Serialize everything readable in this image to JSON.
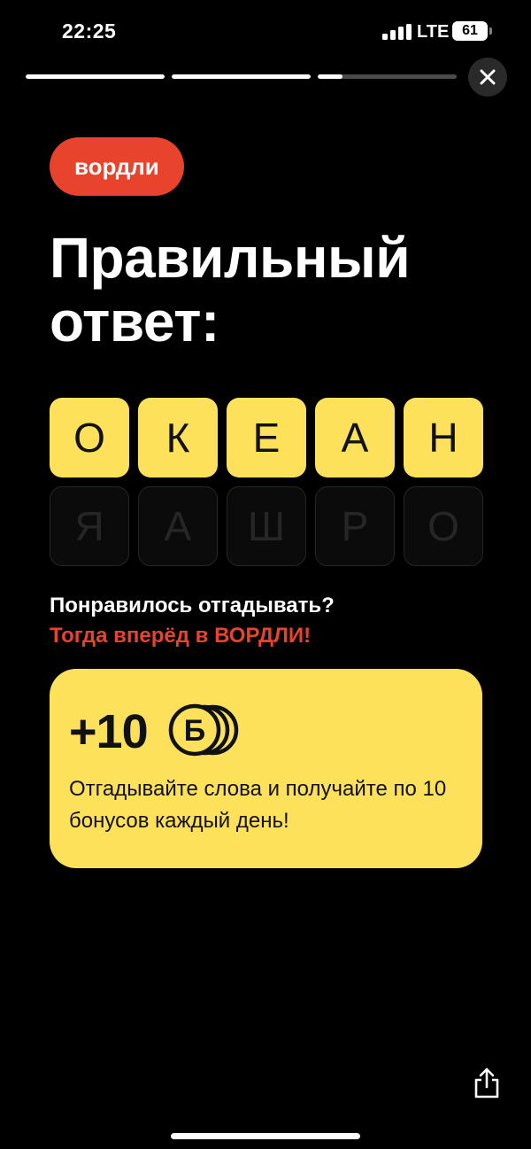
{
  "status_bar": {
    "time": "22:25",
    "network": "LTE",
    "battery": "61"
  },
  "progress": {
    "segments": [
      {
        "fill": 1.0
      },
      {
        "fill": 1.0
      },
      {
        "fill": 0.18
      }
    ]
  },
  "badge": {
    "label": "вордли"
  },
  "title": {
    "line1": "Правильный",
    "line2": "ответ:"
  },
  "answer_tiles": [
    "О",
    "К",
    "Е",
    "А",
    "Н"
  ],
  "hint_tiles": [
    "Я",
    "А",
    "Ш",
    "Р",
    "О"
  ],
  "promo": {
    "line1": "Понравилось отгадывать?",
    "line2": "Тогда вперёд в ВОРДЛИ!"
  },
  "bonus_card": {
    "amount": "+10",
    "coin_symbol": "Б",
    "text": "Отгадывайте слова и получайте по 10 бонусов каждый день!"
  },
  "colors": {
    "accent_red": "#e8432c",
    "accent_yellow": "#fde15b",
    "background": "#000000"
  },
  "icons": {
    "close": "close-icon",
    "share": "share-icon",
    "coin": "coin-icon"
  }
}
